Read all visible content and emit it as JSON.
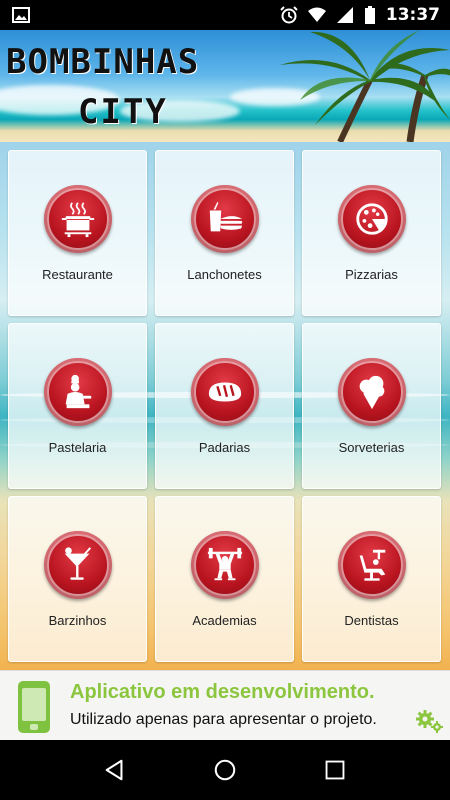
{
  "status_bar": {
    "time": "13:37",
    "icons": [
      "image-icon",
      "alarm-icon",
      "wifi-icon",
      "signal-icon",
      "battery-icon"
    ]
  },
  "header": {
    "title": "BOMBINHAS",
    "subtitle": "CITY"
  },
  "categories": [
    {
      "label": "Restaurante",
      "icon": "cooking-pot-icon"
    },
    {
      "label": "Lanchonetes",
      "icon": "fast-food-icon"
    },
    {
      "label": "Pizzarias",
      "icon": "pizza-icon"
    },
    {
      "label": "Pastelaria",
      "icon": "chef-icon"
    },
    {
      "label": "Padarias",
      "icon": "bread-icon"
    },
    {
      "label": "Sorveterias",
      "icon": "ice-cream-icon"
    },
    {
      "label": "Barzinhos",
      "icon": "cocktail-icon"
    },
    {
      "label": "Academias",
      "icon": "weightlifting-icon"
    },
    {
      "label": "Dentistas",
      "icon": "dentist-chair-icon"
    }
  ],
  "banner": {
    "title": "Aplicativo em desenvolvimento.",
    "subtitle": "Utilizado apenas para apresentar o projeto."
  },
  "colors": {
    "accent_red": "#b8141f",
    "banner_green": "#8cc63f",
    "status_bar": "#000000"
  }
}
